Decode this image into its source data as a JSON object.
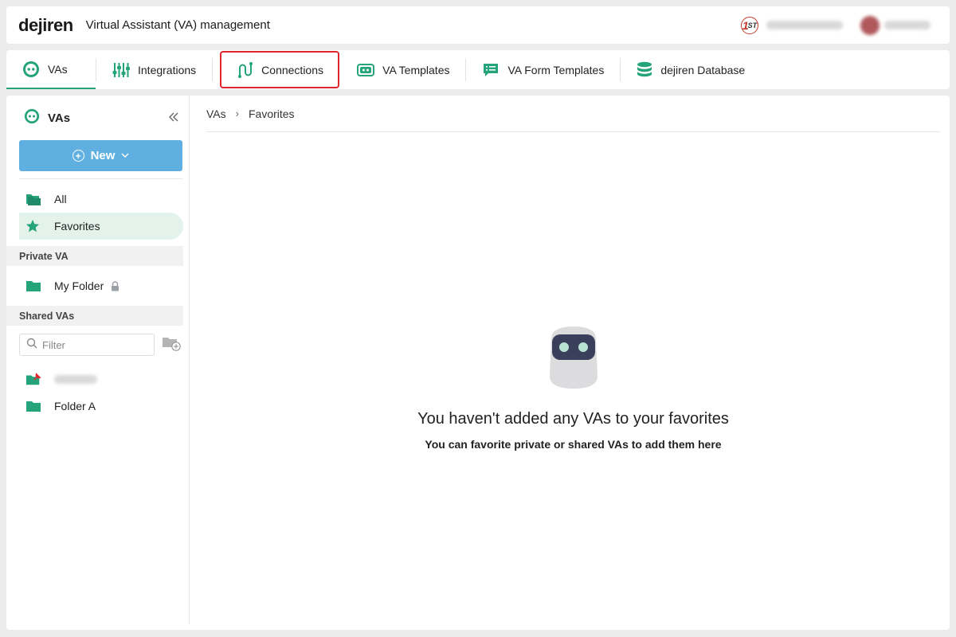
{
  "header": {
    "logo": "dejiren",
    "title": "Virtual Assistant (VA) management",
    "badge": {
      "main": "1",
      "sub": "ST",
      "color": "#c0392b"
    }
  },
  "tabs": [
    {
      "label": "VAs",
      "icon": "robot-icon",
      "active": true
    },
    {
      "label": "Integrations",
      "icon": "sliders-icon"
    },
    {
      "label": "Connections",
      "icon": "connections-icon",
      "highlighted": true
    },
    {
      "label": "VA Templates",
      "icon": "va-template-icon"
    },
    {
      "label": "VA Form Templates",
      "icon": "form-template-icon"
    },
    {
      "label": "dejiren Database",
      "icon": "database-icon"
    }
  ],
  "sidebar": {
    "title": "VAs",
    "collapse_icon": "double-chevron-left-icon",
    "new_label": "New",
    "items": [
      {
        "label": "All",
        "icon": "folders-icon"
      },
      {
        "label": "Favorites",
        "icon": "star-icon",
        "selected": true
      }
    ],
    "private_section": "Private VA",
    "private_items": [
      {
        "label": "My Folder",
        "icon": "folder-icon",
        "locked": true
      }
    ],
    "shared_section": "Shared VAs",
    "filter_placeholder": "Filter",
    "shared_items": [
      {
        "label": "",
        "icon": "pinned-folder-icon",
        "redacted": true
      },
      {
        "label": "Folder A",
        "icon": "folder-icon"
      }
    ]
  },
  "breadcrumb": [
    "VAs",
    "Favorites"
  ],
  "empty_state": {
    "title": "You haven't added any VAs to your favorites",
    "subtitle": "You can favorite private or shared VAs to add them here"
  },
  "colors": {
    "accent": "#25a37a",
    "button": "#5fb0e1",
    "highlight": "#e0262c"
  }
}
